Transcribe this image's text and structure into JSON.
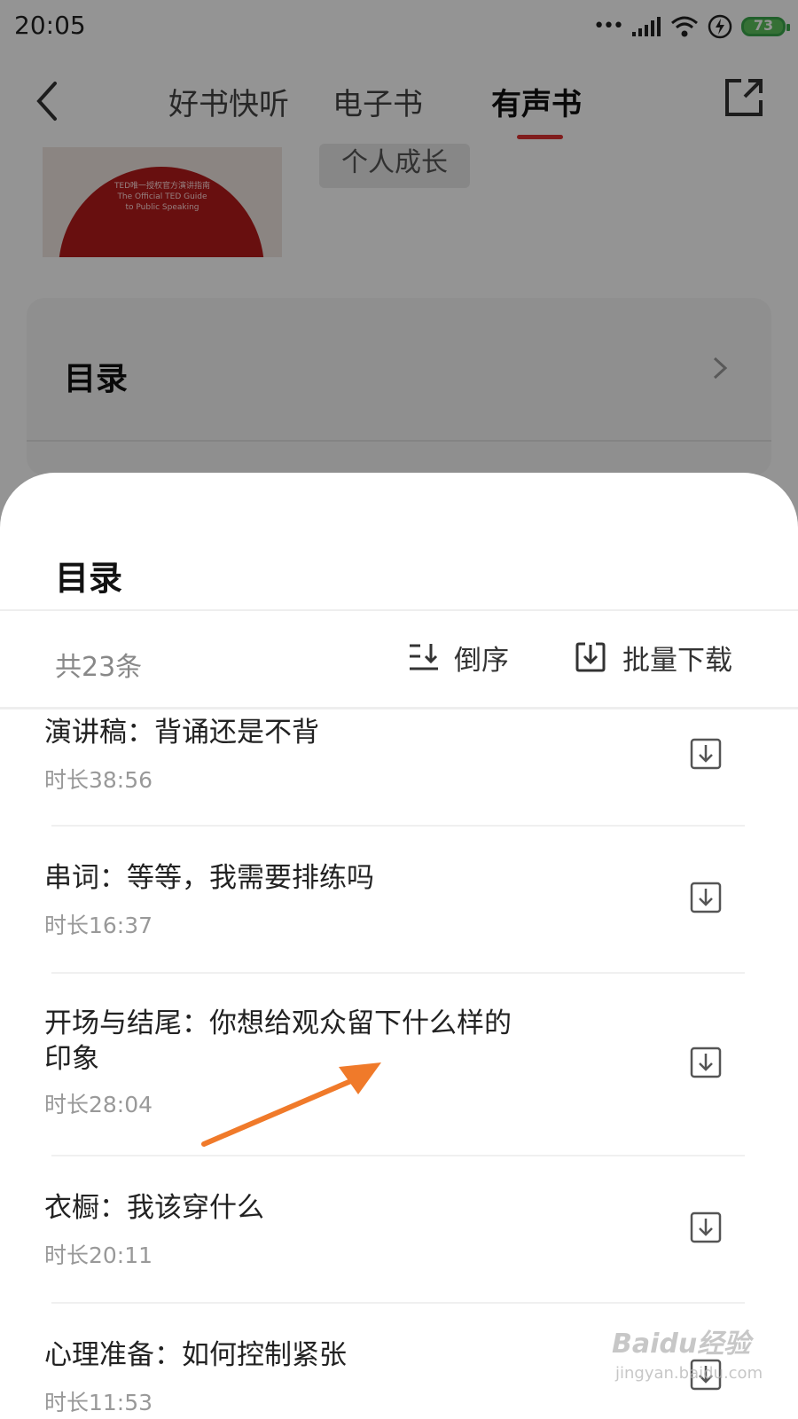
{
  "status_bar": {
    "time": "20:05",
    "battery": "73"
  },
  "nav": {
    "tabs": [
      {
        "label": "好书快听"
      },
      {
        "label": "电子书"
      },
      {
        "label": "有声书"
      }
    ],
    "active_tab": "有声书"
  },
  "book": {
    "cover_text_1": "TED唯一授权官方演讲指南",
    "cover_text_2": "The Official TED Guide",
    "cover_text_3": "to Public Speaking",
    "tag": "个人成长"
  },
  "toc_card": {
    "title": "目录"
  },
  "sheet": {
    "title": "目录",
    "count": "共23条",
    "order_label": "倒序",
    "download_all_label": "批量下载",
    "items": [
      {
        "title": "演讲稿：背诵还是不背",
        "duration": "时长38:56"
      },
      {
        "title": "串词：等等，我需要排练吗",
        "duration": "时长16:37"
      },
      {
        "title": "开场与结尾：你想给观众留下什么样的印象",
        "duration": "时长28:04"
      },
      {
        "title": "衣橱：我该穿什么",
        "duration": "时长20:11"
      },
      {
        "title": "心理准备：如何控制紧张",
        "duration": "时长11:53"
      }
    ]
  },
  "annotation_color": "#f07a2a",
  "accent_color": "#d33333",
  "watermark": {
    "main": "Baidu经验",
    "sub": "jingyan.baidu.com"
  }
}
